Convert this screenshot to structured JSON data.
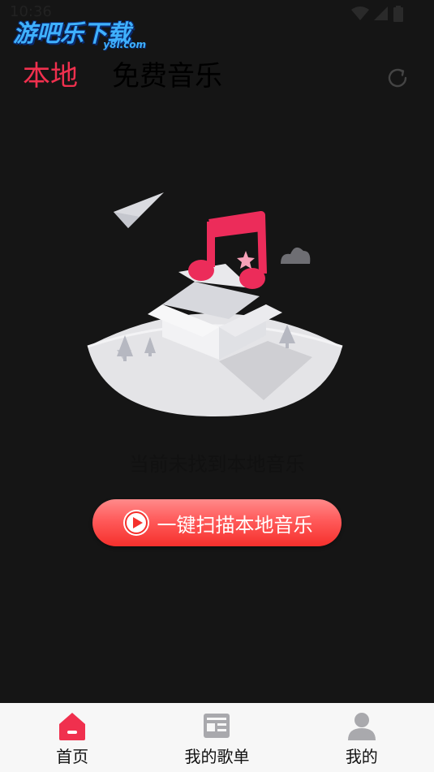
{
  "status_bar": {
    "time": "10:36"
  },
  "watermark": {
    "text": "游吧乐下载",
    "sub": "y8l.com"
  },
  "header": {
    "tabs": [
      {
        "label": "本地",
        "active": true
      },
      {
        "label": "免费音乐",
        "active": false
      }
    ],
    "refresh_icon": "refresh-icon"
  },
  "main": {
    "empty_text": "当前未找到本地音乐",
    "scan_button_label": "一键扫描本地音乐"
  },
  "bottom_nav": {
    "items": [
      {
        "label": "首页",
        "icon": "home-icon",
        "active": true
      },
      {
        "label": "我的歌单",
        "icon": "playlist-icon",
        "active": false
      },
      {
        "label": "我的",
        "icon": "user-icon",
        "active": false
      }
    ]
  },
  "colors": {
    "accent": "#f0304e",
    "button_gradient_top": "#ff8a8a",
    "button_gradient_bottom": "#f5302c",
    "background": "#151515",
    "nav_background": "#f7f7f7"
  }
}
